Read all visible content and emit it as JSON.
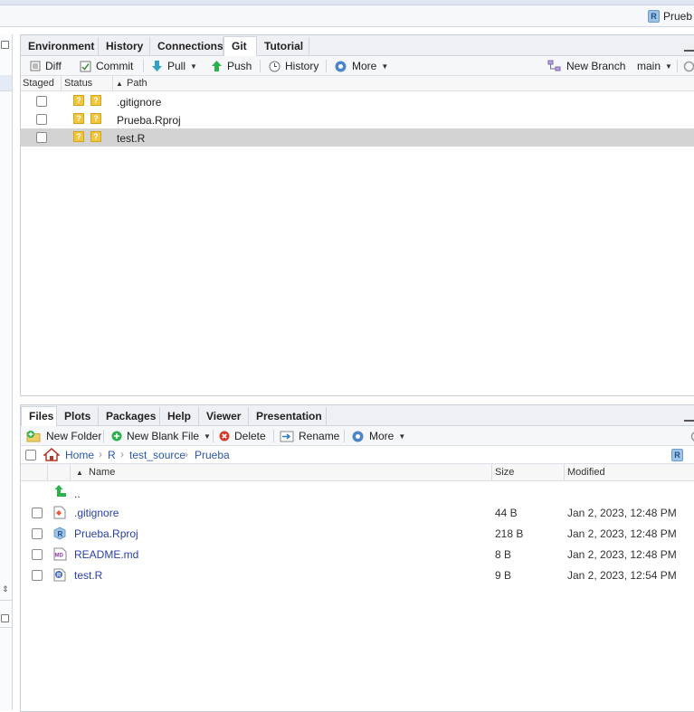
{
  "project": {
    "label": "Prueb",
    "badge": "R"
  },
  "git_pane": {
    "tabs": [
      "Environment",
      "History",
      "Connections",
      "Git",
      "Tutorial"
    ],
    "active_tab": "Git",
    "toolbar": {
      "diff": "Diff",
      "commit": "Commit",
      "pull": "Pull",
      "push": "Push",
      "history": "History",
      "more": "More",
      "new_branch": "New Branch",
      "branch": "main"
    },
    "columns": {
      "staged": "Staged",
      "status": "Status",
      "path": "Path"
    },
    "rows": [
      {
        "path": ".gitignore",
        "status1": "?",
        "status2": "?"
      },
      {
        "path": "Prueba.Rproj",
        "status1": "?",
        "status2": "?"
      },
      {
        "path": "test.R",
        "status1": "?",
        "status2": "?",
        "selected": true
      }
    ]
  },
  "files_pane": {
    "tabs": [
      "Files",
      "Plots",
      "Packages",
      "Help",
      "Viewer",
      "Presentation"
    ],
    "active_tab": "Files",
    "toolbar": {
      "new_folder": "New Folder",
      "new_blank_file": "New Blank File",
      "delete": "Delete",
      "rename": "Rename",
      "more": "More"
    },
    "breadcrumb": [
      "Home",
      "R",
      "test_source",
      "Prueba"
    ],
    "columns": {
      "name": "Name",
      "size": "Size",
      "modified": "Modified"
    },
    "parent_dir": "..",
    "files": [
      {
        "name": ".gitignore",
        "size": "44 B",
        "modified": "Jan 2, 2023, 12:48 PM",
        "icon": "gitignore-icon"
      },
      {
        "name": "Prueba.Rproj",
        "size": "218 B",
        "modified": "Jan 2, 2023, 12:48 PM",
        "icon": "rproj-icon"
      },
      {
        "name": "README.md",
        "size": "8 B",
        "modified": "Jan 2, 2023, 12:48 PM",
        "icon": "markdown-icon"
      },
      {
        "name": "test.R",
        "size": "9 B",
        "modified": "Jan 2, 2023, 12:54 PM",
        "icon": "r-script-icon"
      }
    ]
  },
  "colors": {
    "link": "#2a58a8",
    "file_link": "#2a3fa8",
    "status_badge": "#f2c53d",
    "selected_row": "#d3d3d3"
  }
}
